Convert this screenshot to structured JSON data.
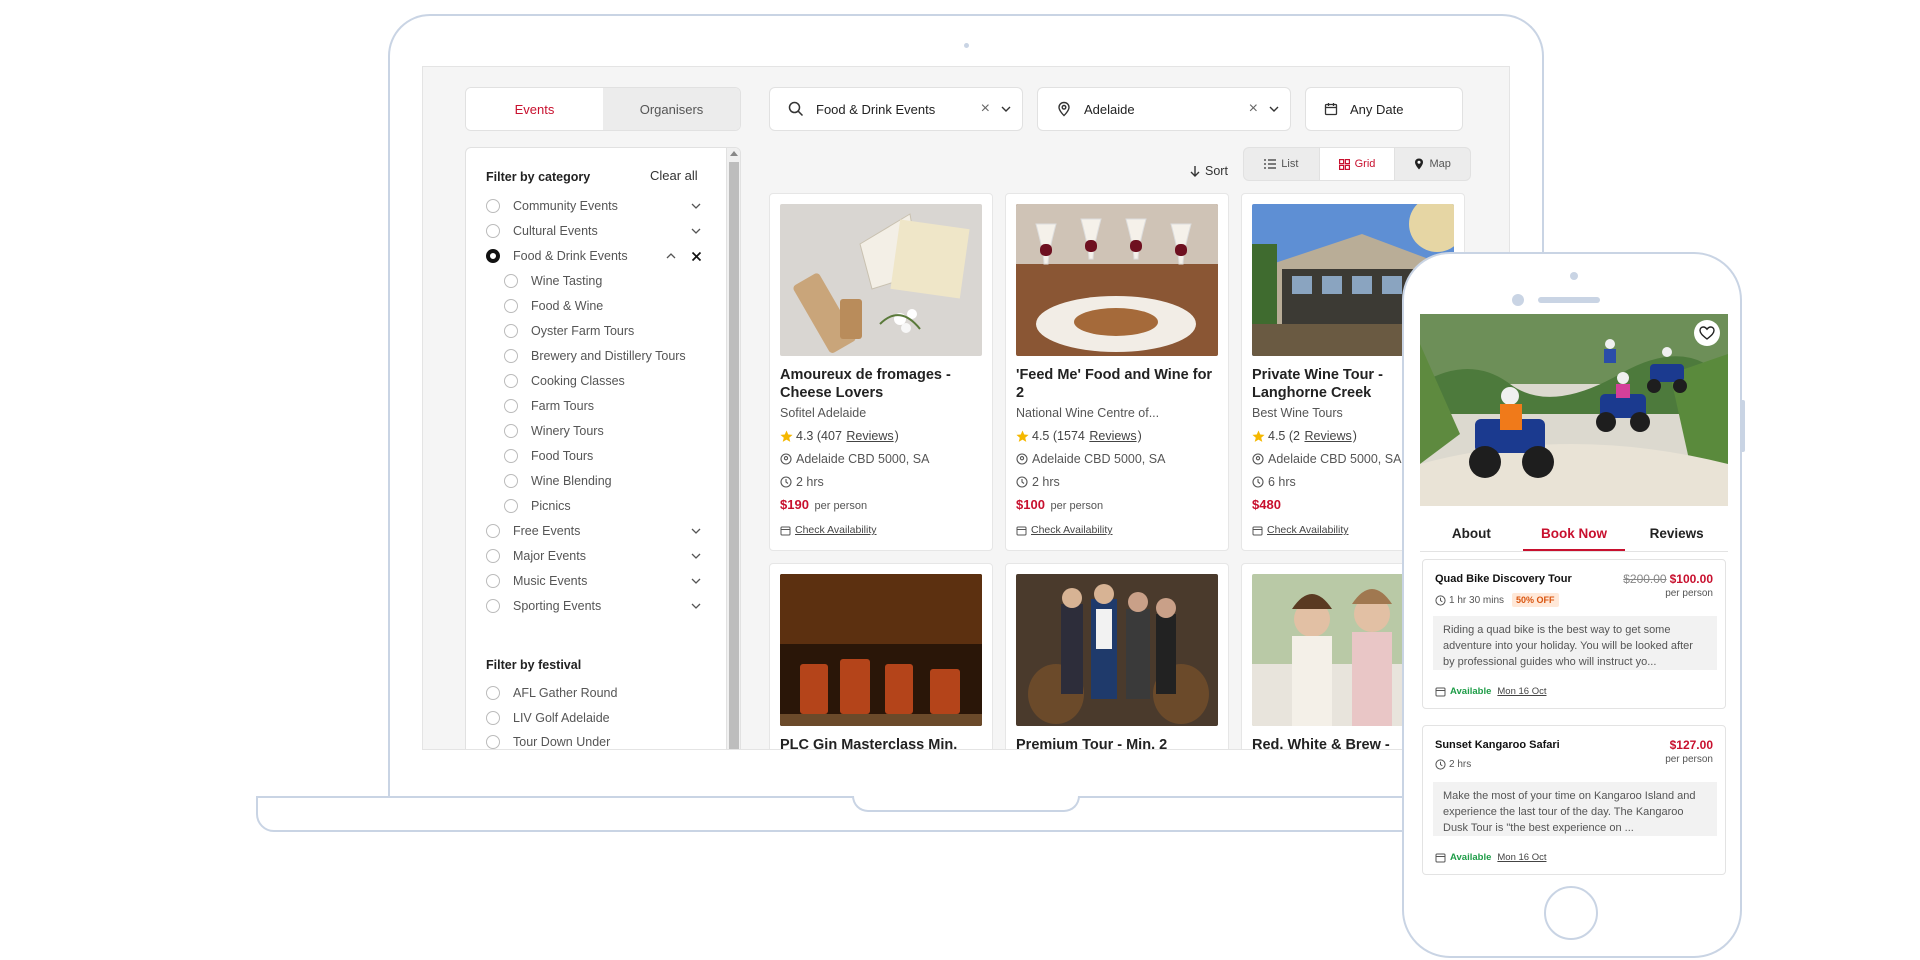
{
  "tabs": {
    "events": "Events",
    "organisers": "Organisers"
  },
  "search": {
    "category_value": "Food & Drink Events",
    "location_value": "Adelaide",
    "date_value": "Any Date"
  },
  "sidebar": {
    "category_heading": "Filter by category",
    "clear_all": "Clear all",
    "categories": [
      {
        "label": "Community Events"
      },
      {
        "label": "Cultural Events"
      },
      {
        "label": "Food & Drink Events",
        "selected": true
      },
      {
        "label": "Wine Tasting"
      },
      {
        "label": "Food & Wine"
      },
      {
        "label": "Oyster Farm Tours"
      },
      {
        "label": "Brewery and Distillery Tours"
      },
      {
        "label": "Cooking Classes"
      },
      {
        "label": "Farm Tours"
      },
      {
        "label": "Winery Tours"
      },
      {
        "label": "Food Tours"
      },
      {
        "label": "Wine Blending"
      },
      {
        "label": "Picnics"
      },
      {
        "label": "Free Events"
      },
      {
        "label": "Major Events"
      },
      {
        "label": "Music Events"
      },
      {
        "label": "Sporting Events"
      }
    ],
    "festival_heading": "Filter by festival",
    "festivals": [
      {
        "label": "AFL Gather Round"
      },
      {
        "label": "LIV Golf Adelaide"
      },
      {
        "label": "Tour Down Under"
      }
    ]
  },
  "toolbar": {
    "sort": "Sort",
    "list": "List",
    "grid": "Grid",
    "map": "Map"
  },
  "cards": [
    {
      "title": "Amoureux de fromages - Cheese Lovers",
      "org": "Sofitel Adelaide",
      "rating": "4.3",
      "reviews_count": "(407",
      "reviews_label": "Reviews",
      "reviews_close": ")",
      "location": "Adelaide CBD 5000, SA",
      "duration": "2 hrs",
      "price": "$190",
      "per": "per person",
      "availability": "Check Availability"
    },
    {
      "title": "'Feed Me' Food and Wine for 2",
      "org": "National Wine Centre of...",
      "rating": "4.5",
      "reviews_count": "(1574",
      "reviews_label": "Reviews",
      "reviews_close": ")",
      "location": "Adelaide CBD 5000, SA",
      "duration": "2 hrs",
      "price": "$100",
      "per": "per person",
      "availability": "Check Availability"
    },
    {
      "title": "Private Wine Tour - Langhorne Creek",
      "org": "Best Wine Tours",
      "rating": "4.5",
      "reviews_count": "(2",
      "reviews_label": "Reviews",
      "reviews_close": ")",
      "location": "Adelaide CBD 5000, SA",
      "duration": "6 hrs",
      "price": "$480",
      "per": "",
      "availability": "Check Availability"
    },
    {
      "title": "PLC Gin Masterclass Min."
    },
    {
      "title": "Premium Tour - Min. 2"
    },
    {
      "title": "Red, White & Brew -"
    }
  ],
  "phone": {
    "tabs": {
      "about": "About",
      "book_now": "Book Now",
      "reviews": "Reviews"
    },
    "tours": [
      {
        "name": "Quad Bike Discovery Tour",
        "old_price": "$200.00",
        "price": "$100.00",
        "per": "per person",
        "duration": "1 hr 30 mins",
        "badge": "50% OFF",
        "description": "Riding a quad bike is the best way to get some adventure into your holiday. You will be looked after by professional guides who will instruct yo...",
        "status": "Available",
        "date": "Mon 16 Oct"
      },
      {
        "name": "Sunset Kangaroo Safari",
        "price": "$127.00",
        "per": "per person",
        "duration": "2 hrs",
        "description": "Make the most of your time on Kangaroo Island and experience the last tour of the day. The Kangaroo Dusk Tour is \"the best experience on ...",
        "status": "Available",
        "date": "Mon 16 Oct"
      }
    ]
  },
  "colors": {
    "accent": "#c8102e",
    "available": "#1f9d48",
    "frame": "#c9d4e4",
    "badge_bg": "#ffe8d8"
  }
}
